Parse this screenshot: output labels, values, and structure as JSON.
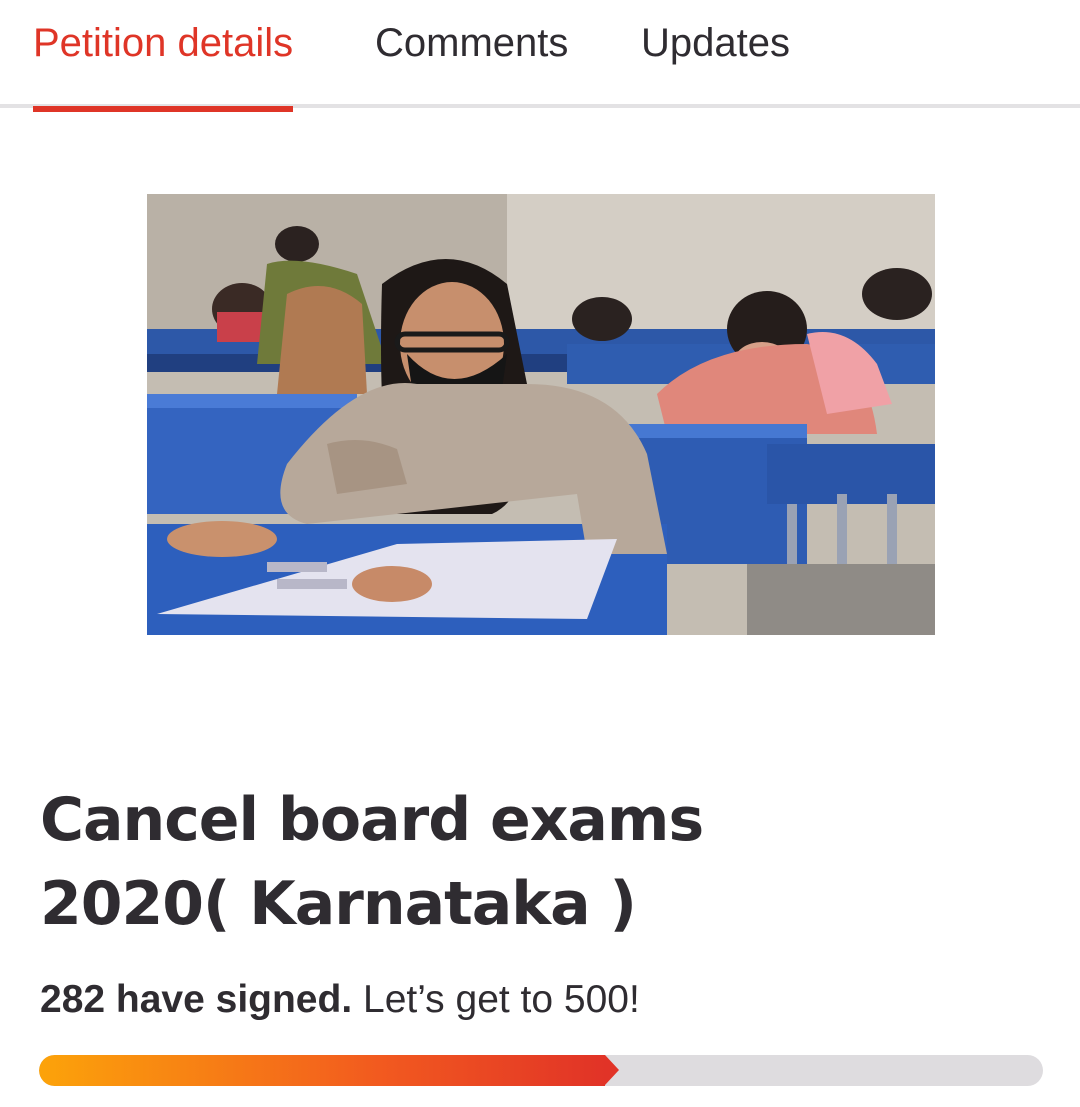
{
  "tabs": [
    {
      "label": "Petition details",
      "active": true
    },
    {
      "label": "Comments",
      "active": false
    },
    {
      "label": "Updates",
      "active": false
    }
  ],
  "petition": {
    "title": "Cancel board exams 2020( Karnataka )",
    "signed_count_text": "282 have signed.",
    "goal_text": "Let’s get to 500!",
    "signatures": 282,
    "goal": 500,
    "progress_fraction": 0.564
  },
  "colors": {
    "accent": "#df3527",
    "text": "#2f2c31",
    "track": "#dedcdf",
    "progress_start": "#fca30a",
    "progress_end": "#e13327"
  }
}
